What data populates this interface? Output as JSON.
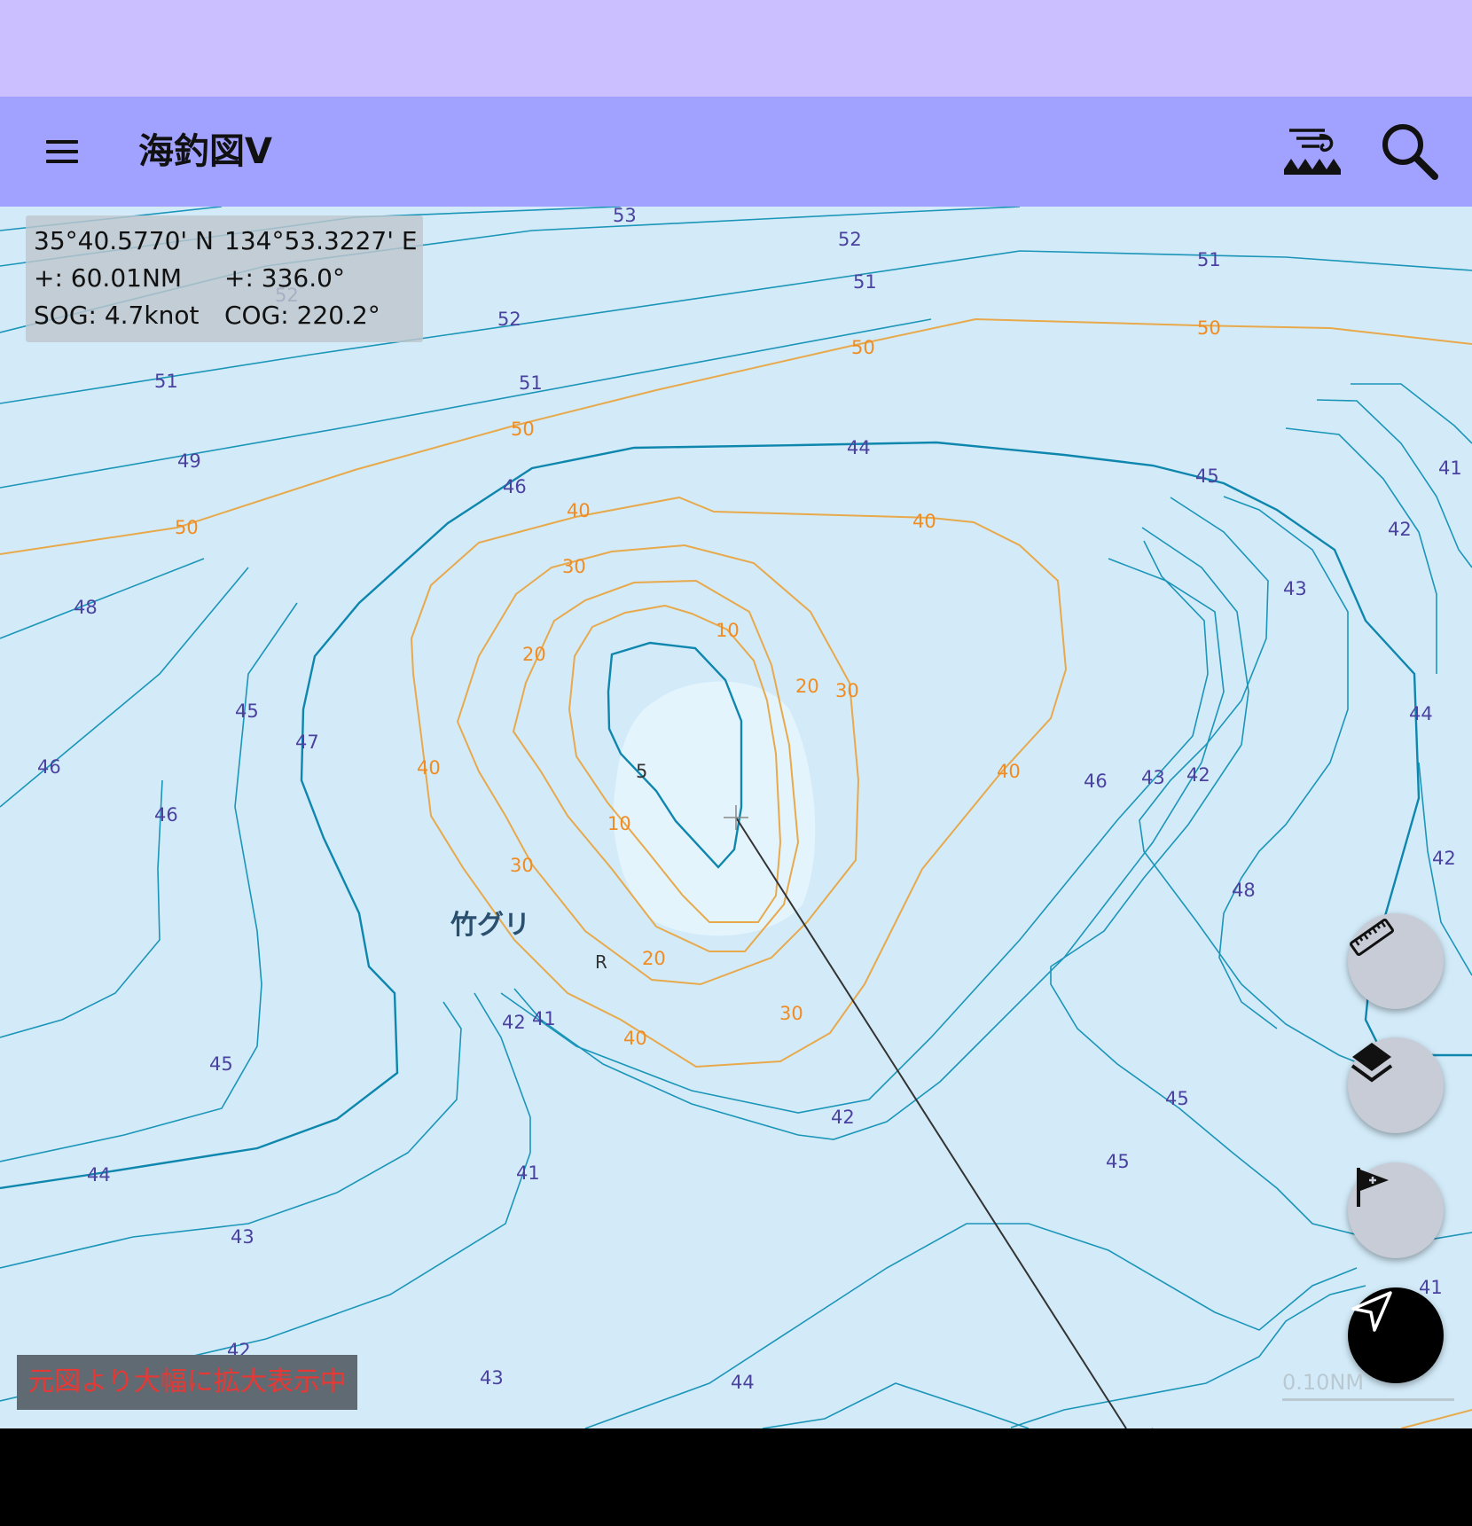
{
  "app": {
    "title": "海釣図V"
  },
  "appbar": {
    "menu_icon": "hamburger-menu-icon",
    "tide_icon": "tide-wave-icon",
    "search_icon": "search-icon"
  },
  "info_panel": {
    "lat": "35°40.5770' N",
    "lon": "134°53.3227' E",
    "distance": "+: 60.01NM",
    "bearing": "+: 336.0°",
    "sog": "SOG: 4.7knot",
    "cog": "COG: 220.2°"
  },
  "map": {
    "place_name": "竹グリ",
    "marker_R": "R",
    "depth_labels_blue": [
      "53",
      "52",
      "51",
      "52",
      "51",
      "52",
      "51",
      "51",
      "49",
      "48",
      "46",
      "45",
      "47",
      "46",
      "45",
      "44",
      "43",
      "42",
      "41",
      "42",
      "41",
      "42",
      "43",
      "44",
      "45",
      "45",
      "48",
      "46",
      "44",
      "45",
      "41",
      "42",
      "43",
      "44",
      "46",
      "43",
      "42",
      "42",
      "41"
    ],
    "depth_labels_orange": [
      "50",
      "50",
      "50",
      "50",
      "40",
      "40",
      "30",
      "20",
      "10",
      "5",
      "40",
      "10",
      "30",
      "20",
      "30",
      "20",
      "30",
      "40",
      "40"
    ]
  },
  "notice": "元図より大幅に拡大表示中",
  "scale_label": "0.10NM",
  "buttons": {
    "ruler_icon": "ruler-icon",
    "layers_icon": "layers-icon",
    "flag_icon": "add-flag-icon",
    "locate_icon": "navigation-arrow-icon"
  },
  "colors": {
    "status_bar": "#ccbfff",
    "app_bar": "#a1a1ff",
    "sea": "#d3ebf9",
    "contour_blue": "#1b95b8",
    "contour_orange": "#e7a94b",
    "notice_text": "#e53935"
  }
}
